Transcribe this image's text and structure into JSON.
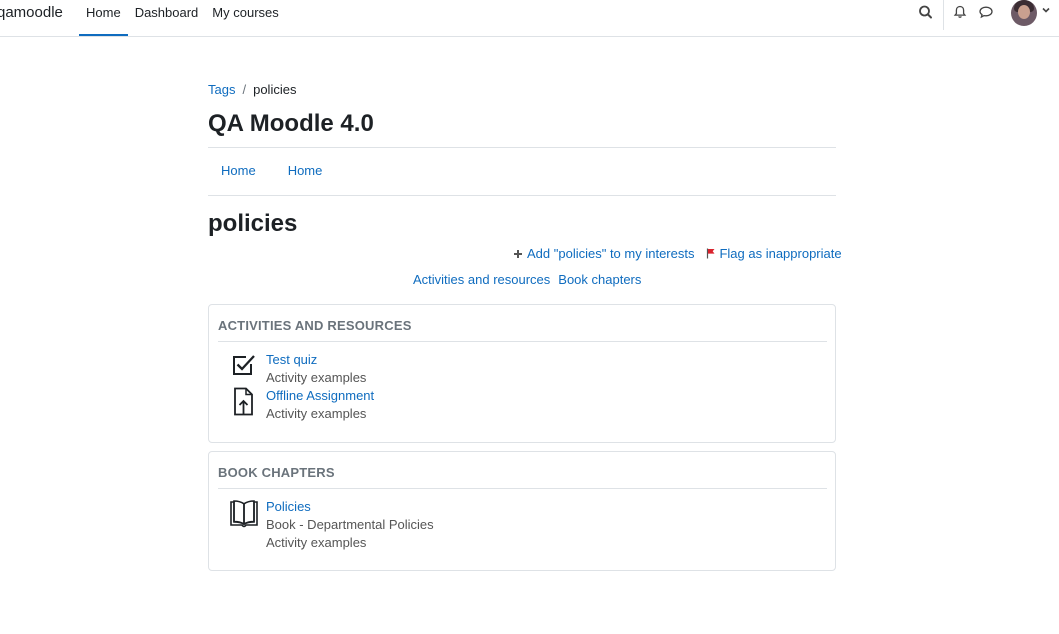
{
  "navbar": {
    "brand": "qamoodle",
    "items": [
      {
        "label": "Home",
        "active": true
      },
      {
        "label": "Dashboard",
        "active": false
      },
      {
        "label": "My courses",
        "active": false
      }
    ],
    "icons": [
      "search-icon",
      "bell-icon",
      "chat-icon",
      "avatar",
      "chevron-down-icon"
    ]
  },
  "breadcrumb": {
    "items": [
      "Tags",
      "policies"
    ],
    "separator": "/"
  },
  "course": {
    "title": "QA Moodle 4.0"
  },
  "secondary_nav": {
    "items": [
      "Home",
      "Home"
    ]
  },
  "tag": {
    "name": "policies",
    "add_interest": "Add \"policies\" to my interests",
    "flag": "Flag as inappropriate"
  },
  "jump_links": [
    "Activities and resources",
    "Book chapters"
  ],
  "sections": {
    "activities": {
      "header": "ACTIVITIES AND RESOURCES",
      "items": [
        {
          "title": "Test quiz",
          "meta": "Activity examples",
          "icon": "quiz-checkbox-icon"
        },
        {
          "title": "Offline Assignment",
          "meta": "Activity examples",
          "icon": "assignment-upload-icon"
        }
      ]
    },
    "chapters": {
      "header": "BOOK CHAPTERS",
      "items": [
        {
          "title": "Policies",
          "meta1": "Book - Departmental Policies",
          "meta2": "Activity examples",
          "icon": "book-icon"
        }
      ]
    }
  },
  "colors": {
    "link": "#0f6cbf",
    "text": "#1d2125",
    "muted": "#6a737b",
    "border": "#dee2e6",
    "flag": "#d9232d"
  }
}
